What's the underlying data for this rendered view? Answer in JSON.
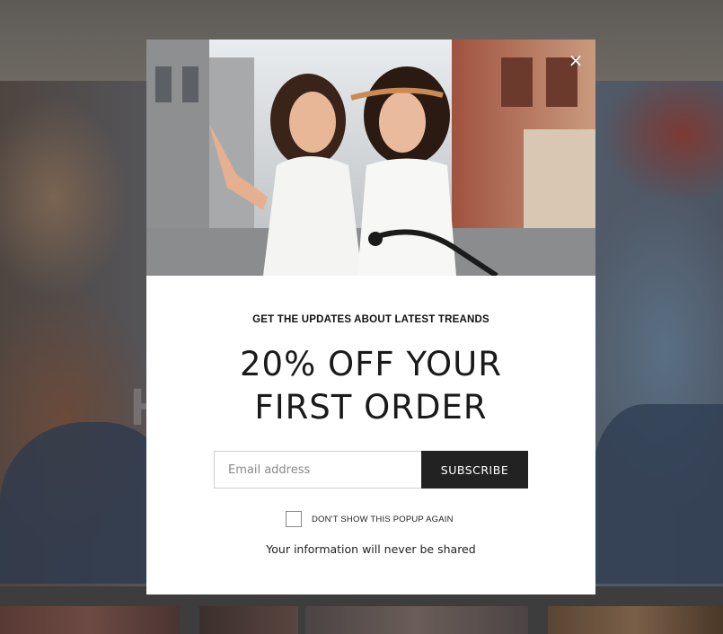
{
  "background": {
    "hero_text": "H"
  },
  "popup": {
    "close_icon": "×",
    "eyebrow": "GET THE UPDATES ABOUT LATEST TREANDS",
    "headline_line1": "20% OFF YOUR",
    "headline_line2": "FIRST ORDER",
    "email_placeholder": "Email address",
    "email_value": "",
    "subscribe_label": "SUBSCRIBE",
    "dont_show_label": "DON'T SHOW THIS POPUP AGAIN",
    "dont_show_checked": false,
    "privacy_note": "Your information will never be shared"
  }
}
